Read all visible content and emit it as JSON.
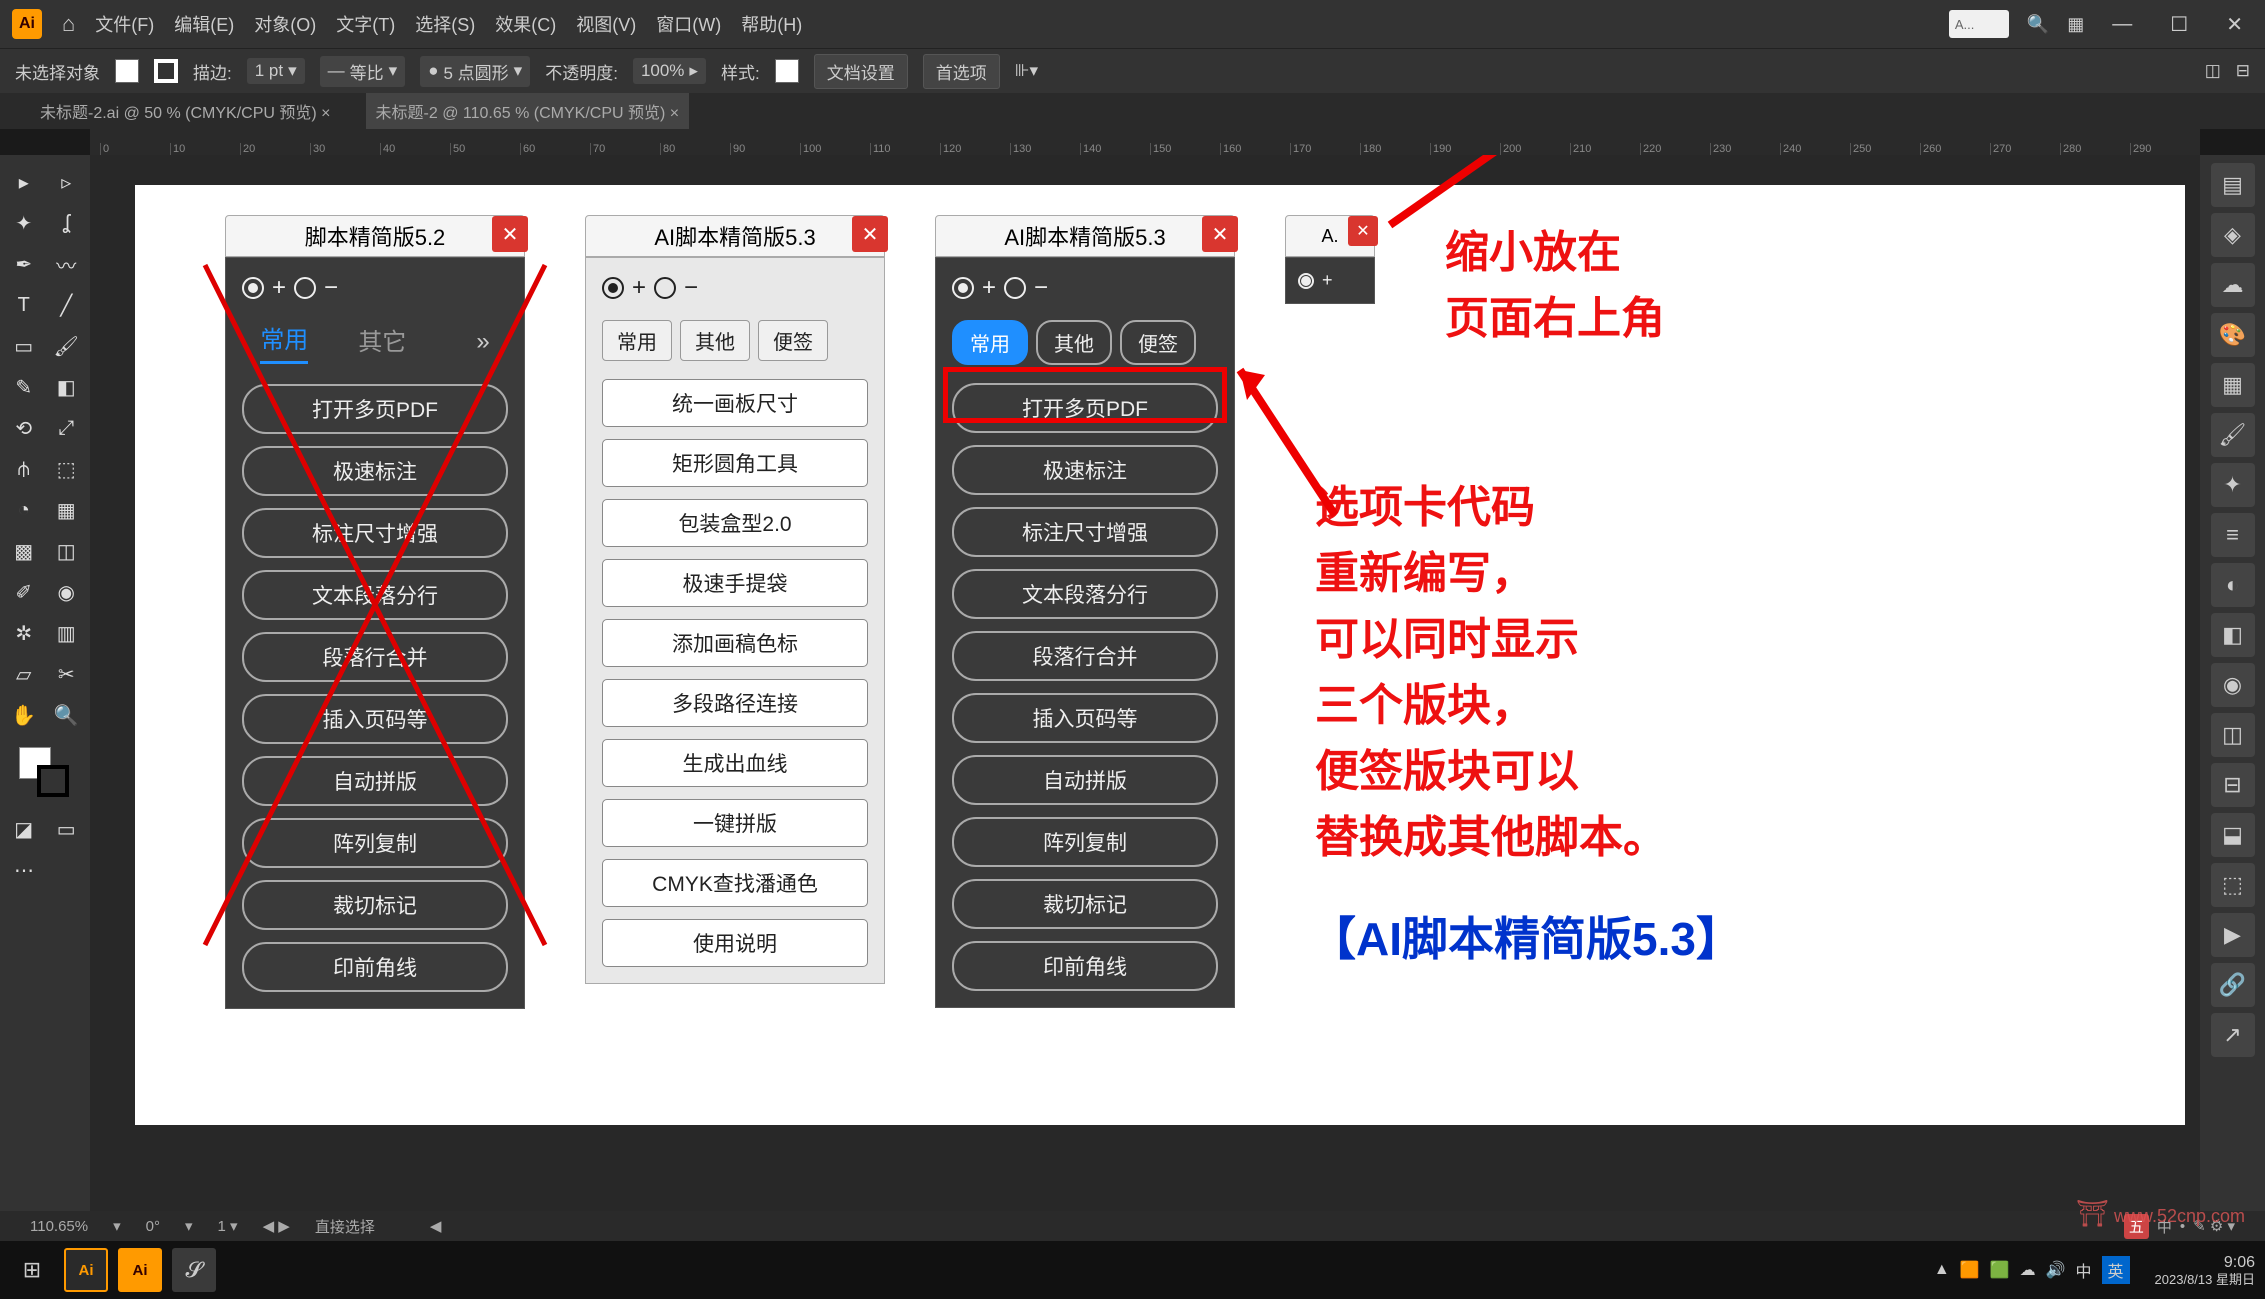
{
  "menubar": {
    "items": [
      "文件(F)",
      "编辑(E)",
      "对象(O)",
      "文字(T)",
      "选择(S)",
      "效果(C)",
      "视图(V)",
      "窗口(W)",
      "帮助(H)"
    ],
    "searchPlaceholder": "A..."
  },
  "optionsbar": {
    "noSelection": "未选择对象",
    "strokeLabel": "描边:",
    "strokeValue": "1 pt",
    "uniformLabel": "等比",
    "pointRound": "5 点圆形",
    "opacityLabel": "不透明度:",
    "opacityValue": "100%",
    "styleLabel": "样式:",
    "docSetup": "文档设置",
    "prefs": "首选项"
  },
  "tabs": {
    "tab1": "未标题-2.ai @ 50 % (CMYK/CPU 预览)",
    "tab2": "未标题-2 @ 110.65 % (CMYK/CPU 预览)"
  },
  "rulerTicks": [
    "0",
    "10",
    "20",
    "30",
    "40",
    "50",
    "60",
    "70",
    "80",
    "90",
    "100",
    "110",
    "120",
    "130",
    "140",
    "150",
    "160",
    "170",
    "180",
    "190",
    "200",
    "210",
    "220",
    "230",
    "240",
    "250",
    "260",
    "270",
    "280",
    "290"
  ],
  "panels": {
    "p52": {
      "title": "脚本精简版5.2",
      "tabs": [
        "常用",
        "其它"
      ],
      "buttons": [
        "打开多页PDF",
        "极速标注",
        "标注尺寸增强",
        "文本段落分行",
        "段落行合并",
        "插入页码等",
        "自动拼版",
        "阵列复制",
        "裁切标记",
        "印前角线"
      ]
    },
    "p53light": {
      "title": "AI脚本精简版5.3",
      "tabs": [
        "常用",
        "其他",
        "便签"
      ],
      "buttons": [
        "统一画板尺寸",
        "矩形圆角工具",
        "包装盒型2.0",
        "极速手提袋",
        "添加画稿色标",
        "多段路径连接",
        "生成出血线",
        "一键拼版",
        "CMYK查找潘通色",
        "使用说明"
      ]
    },
    "p53dark": {
      "title": "AI脚本精简版5.3",
      "tabs": [
        "常用",
        "其他",
        "便签"
      ],
      "buttons": [
        "打开多页PDF",
        "极速标注",
        "标注尺寸增强",
        "文本段落分行",
        "段落行合并",
        "插入页码等",
        "自动拼版",
        "阵列复制",
        "裁切标记",
        "印前角线"
      ]
    },
    "mini": {
      "title": "A."
    }
  },
  "annotations": {
    "topRight1": "缩小放在",
    "topRight2": "页面右上角",
    "body1": "选项卡代码",
    "body2": "重新编写，",
    "body3": "可以同时显示",
    "body4": "三个版块，",
    "body5": "便签版块可以",
    "body6": "替换成其他脚本。",
    "blue": "【AI脚本精简版5.3】"
  },
  "statusbar": {
    "zoom": "110.65%",
    "rot": "0°",
    "sel": "直接选择"
  },
  "taskbar": {
    "time": "9:06",
    "date": "2023/8/13 星期日",
    "imeLabels": [
      "五",
      "中",
      "英"
    ]
  },
  "watermark": "www.52cnp.com"
}
